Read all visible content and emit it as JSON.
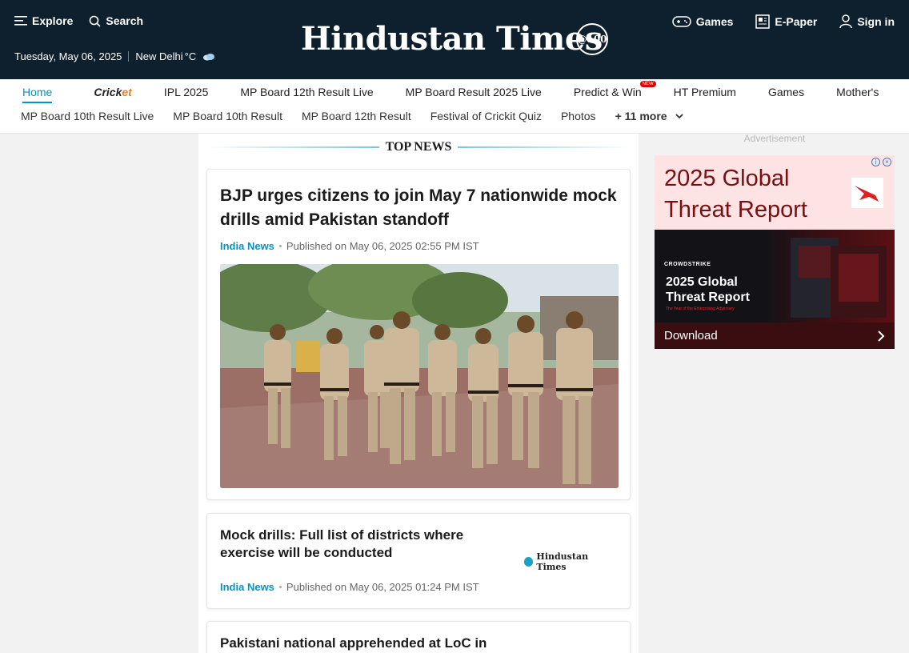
{
  "header": {
    "explore": "Explore",
    "search": "Search",
    "logo": "Hindustan Times",
    "badge": "@100",
    "date": "Tuesday, May 06, 2025",
    "location": "New Delhi",
    "temp_unit": "°C",
    "games": "Games",
    "epaper": "E-Paper",
    "signin": "Sign in"
  },
  "nav": {
    "row1": [
      "Home",
      "Cricket",
      "IPL 2025",
      "MP Board 12th Result Live",
      "MP Board Result 2025 Live",
      "Predict & Win",
      "HT Premium",
      "Games",
      "Mother's"
    ],
    "new_tag": "NEW",
    "row2": [
      "MP Board 10th Result Live",
      "MP Board 10th Result",
      "MP Board 12th Result",
      "Festival of Crickit Quiz",
      "Photos"
    ],
    "more": "+ 11 more"
  },
  "feed": {
    "section_title": "TOP NEWS",
    "lead": {
      "title": "BJP urges citizens to join May 7 nationwide mock drills amid Pakistan standoff",
      "category": "India News",
      "published": "Published on May 06, 2025 02:55 PM IST"
    },
    "story1": {
      "title": "Mock drills: Full list of districts where exercise will be conducted",
      "category": "India News",
      "published": "Published on May 06, 2025 01:24 PM IST",
      "thumb_text": "Hindustan Times"
    },
    "story2": {
      "title": "Pakistani national apprehended at LoC in"
    }
  },
  "ad": {
    "label": "Advertisement",
    "headline": "2025 Global Threat Report",
    "brand": "CROWDSTRIKE",
    "sub_headline": "2025 Global Threat Report",
    "tagline": "The Year of the Enterprising Adversary",
    "cta": "Download"
  },
  "colors": {
    "header_bg": "#0e202d",
    "accent": "#0094c9",
    "ad_red": "#7a0f12"
  }
}
